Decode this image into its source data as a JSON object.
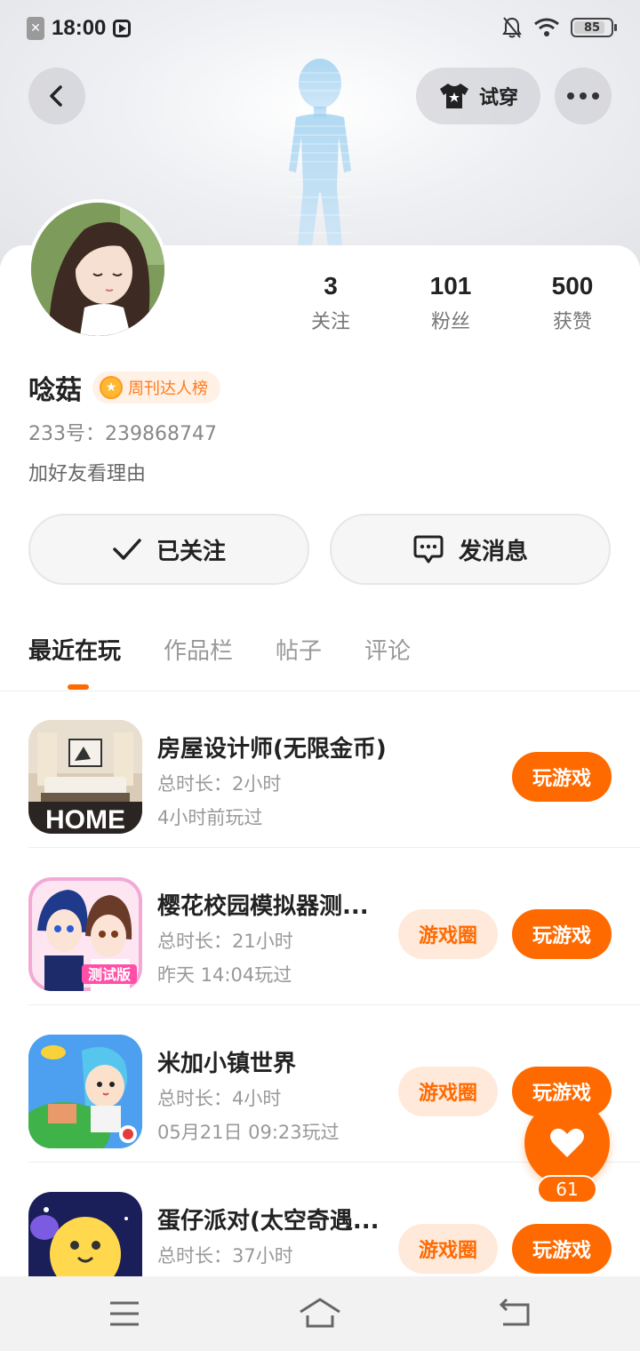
{
  "status_bar": {
    "time": "18:00",
    "battery": "85",
    "battery_level": 0.85
  },
  "header": {
    "tryon_label": "试穿"
  },
  "profile": {
    "username": "唸菇",
    "badge": "周刊达人榜",
    "user_id": "233号：239868747",
    "bio": "加好友看理由",
    "stats": [
      {
        "value": "3",
        "label": "关注"
      },
      {
        "value": "101",
        "label": "粉丝"
      },
      {
        "value": "500",
        "label": "获赞"
      }
    ]
  },
  "actions": {
    "follow_label": "已关注",
    "message_label": "发消息"
  },
  "tabs": [
    "最近在玩",
    "作品栏",
    "帖子",
    "评论"
  ],
  "games": [
    {
      "title": "房屋设计师(无限金币)",
      "duration": "总时长：2小时",
      "last_played": "4小时前玩过",
      "icon_text": "HOME",
      "has_circle": false
    },
    {
      "title": "樱花校园模拟器测...",
      "duration": "总时长：21小时",
      "last_played": "昨天 14:04玩过",
      "icon_text": "测试版",
      "has_circle": true
    },
    {
      "title": "米加小镇世界",
      "duration": "总时长：4小时",
      "last_played": "05月21日 09:23玩过",
      "has_circle": true
    },
    {
      "title": "蛋仔派对(太空奇遇...",
      "duration": "总时长：37小时",
      "last_played": "",
      "has_circle": true
    }
  ],
  "game_buttons": {
    "play": "玩游戏",
    "circle": "游戏圈"
  },
  "like": {
    "count": "61"
  },
  "colors": {
    "accent": "#ff6a00",
    "accent_light": "#ffe9da"
  }
}
